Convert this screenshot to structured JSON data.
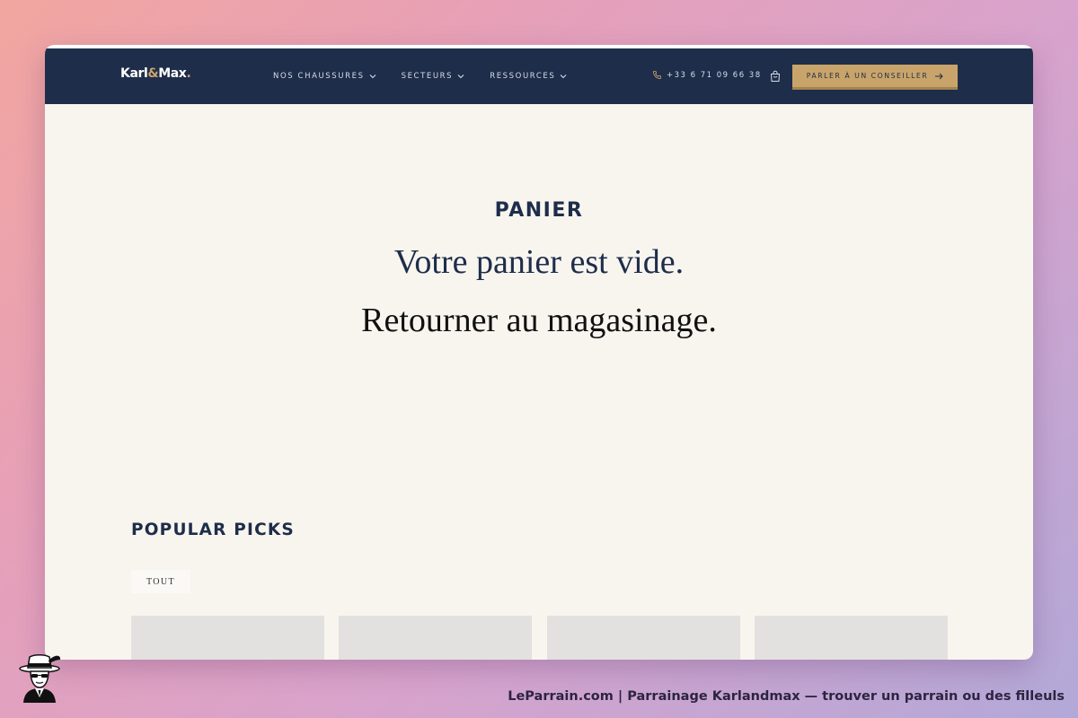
{
  "header": {
    "logo_part1": "Karl",
    "logo_amp": "&",
    "logo_part2": "Max",
    "logo_dot": ".",
    "nav_items": [
      {
        "label": "NOS CHAUSSURES"
      },
      {
        "label": "SECTEURS"
      },
      {
        "label": "RESSOURCES"
      }
    ],
    "phone": "+33 6 71 09 66 38",
    "cta_label": "PARLER À UN CONSEILLER"
  },
  "cart": {
    "title": "PANIER",
    "empty_message": "Votre panier est vide.",
    "back_link": "Retourner au magasinage."
  },
  "popular": {
    "heading": "POPULAR PICKS",
    "filter_tab": "TOUT",
    "product_count_visible": 4
  },
  "footer": {
    "caption": "LeParrain.com | Parrainage Karlandmax — trouver un parrain ou des filleuls"
  },
  "icons": {
    "nav_chevron": "chevron-down-icon",
    "phone": "phone-icon",
    "cart": "shopping-bag-icon",
    "cta_arrow": "arrow-right-icon",
    "mascot": "mascot-icon"
  },
  "colors": {
    "navy": "#1e2d4a",
    "gold": "#c9a46a",
    "page_bg": "#f8f5ef",
    "card_placeholder": "#e2e1df"
  }
}
